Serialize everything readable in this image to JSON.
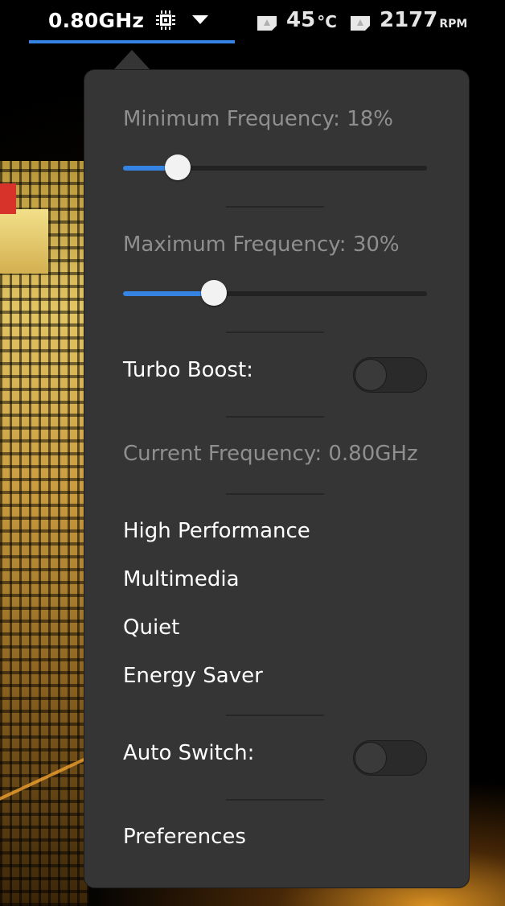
{
  "panel": {
    "frequency_label": "0.80GHz",
    "temperature": {
      "value": "45",
      "unit": "°C"
    },
    "fan": {
      "value": "2177",
      "unit": "RPM"
    }
  },
  "popup": {
    "min_frequency": {
      "label": "Minimum Frequency:",
      "value": "18%",
      "fraction": 0.18
    },
    "max_frequency": {
      "label": "Maximum Frequency:",
      "value": "30%",
      "fraction": 0.3
    },
    "turbo_boost": {
      "label": "Turbo Boost:",
      "on": false
    },
    "current_frequency": {
      "label": "Current Frequency:",
      "value": "0.80GHz"
    },
    "profiles": [
      "High Performance",
      "Multimedia",
      "Quiet",
      "Energy Saver"
    ],
    "auto_switch": {
      "label": "Auto Switch:",
      "on": false
    },
    "preferences_label": "Preferences"
  },
  "colors": {
    "accent": "#3584e4",
    "popup_bg": "#353535",
    "text": "#ffffff",
    "text_dim": "#8f8f8f"
  },
  "icons": {
    "frequency": "cpu-chip-icon",
    "dropdown": "triangle-down-icon",
    "sensor": "sensor-warning-icon"
  }
}
